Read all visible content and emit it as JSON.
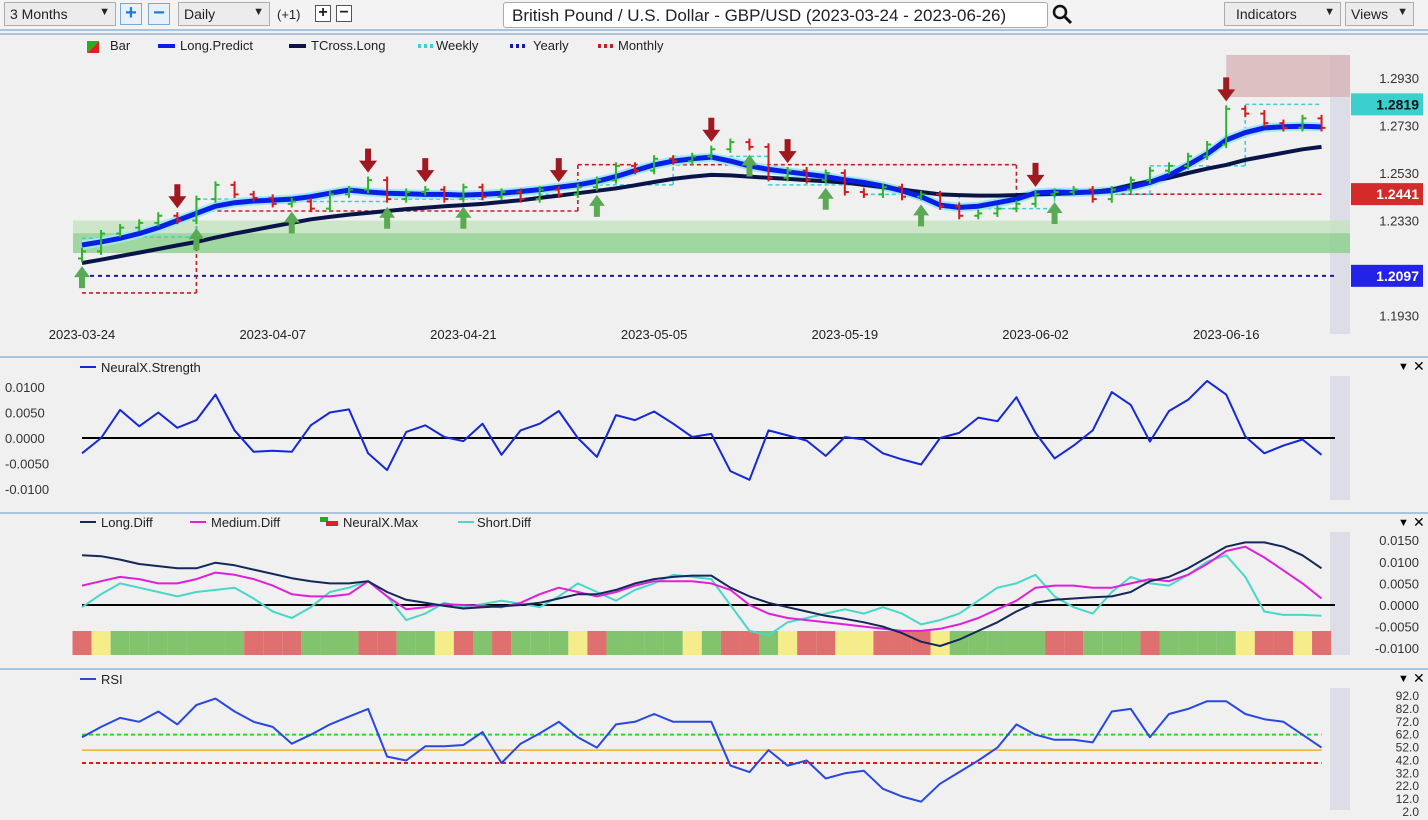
{
  "toolbar": {
    "range": "3 Months",
    "interval": "Daily",
    "offset": "(+1)",
    "title": "British Pound / U.S. Dollar - GBP/USD (2023-03-24 - 2023-06-26)",
    "indicators": "Indicators",
    "views": "Views"
  },
  "colors": {
    "long_predict": "#0a1fe6",
    "tcross": "#0a1448",
    "weekly": "#3ccfd0",
    "yearly": "#1a1ab0",
    "monthly": "#c0202a",
    "bar_up": "#2db32d",
    "bar_down": "#d41c1c",
    "arrow_up": "#5aaa55",
    "arrow_down": "#a01820",
    "strength": "#1428d8",
    "long_diff": "#14285a",
    "medium_diff": "#e020d8",
    "short_diff": "#48d8c8",
    "rsi": "#2848e0",
    "max_green": "#82c46e",
    "max_red": "#e07070",
    "max_yellow": "#f5ec8a"
  },
  "main": {
    "legend": [
      "Bar",
      "Long.Predict",
      "TCross.Long",
      "Weekly",
      "Yearly",
      "Monthly"
    ],
    "x_ticks": [
      "2023-03-24",
      "2023-04-07",
      "2023-04-21",
      "2023-05-05",
      "2023-05-19",
      "2023-06-02",
      "2023-06-16"
    ],
    "y_ticks": [
      "1.2930",
      "1.2730",
      "1.2530",
      "1.2330",
      "1.1930"
    ],
    "price_labels": [
      {
        "text": "1.2819",
        "value": 1.2819,
        "color": "#3ccfd0"
      },
      {
        "text": "1.2441",
        "value": 1.2441,
        "color": "#d42a2a"
      },
      {
        "text": "1.2097",
        "value": 1.2097,
        "color": "#2222e8"
      }
    ],
    "dates": [
      "2023-03-24",
      "2023-03-27",
      "2023-03-28",
      "2023-03-29",
      "2023-03-30",
      "2023-03-31",
      "2023-04-03",
      "2023-04-04",
      "2023-04-05",
      "2023-04-06",
      "2023-04-07",
      "2023-04-10",
      "2023-04-11",
      "2023-04-12",
      "2023-04-13",
      "2023-04-14",
      "2023-04-17",
      "2023-04-18",
      "2023-04-19",
      "2023-04-20",
      "2023-04-21",
      "2023-04-24",
      "2023-04-25",
      "2023-04-26",
      "2023-04-27",
      "2023-04-28",
      "2023-05-01",
      "2023-05-02",
      "2023-05-03",
      "2023-05-04",
      "2023-05-05",
      "2023-05-08",
      "2023-05-09",
      "2023-05-10",
      "2023-05-11",
      "2023-05-12",
      "2023-05-15",
      "2023-05-16",
      "2023-05-17",
      "2023-05-18",
      "2023-05-19",
      "2023-05-22",
      "2023-05-23",
      "2023-05-24",
      "2023-05-25",
      "2023-05-26",
      "2023-05-29",
      "2023-05-30",
      "2023-05-31",
      "2023-06-01",
      "2023-06-02",
      "2023-06-05",
      "2023-06-06",
      "2023-06-07",
      "2023-06-08",
      "2023-06-09",
      "2023-06-12",
      "2023-06-13",
      "2023-06-14",
      "2023-06-15",
      "2023-06-16",
      "2023-06-19",
      "2023-06-20",
      "2023-06-21",
      "2023-06-22",
      "2023-06-23"
    ],
    "close": [
      1.22,
      1.2275,
      1.23,
      1.232,
      1.235,
      1.233,
      1.242,
      1.248,
      1.244,
      1.2425,
      1.24,
      1.241,
      1.238,
      1.244,
      1.246,
      1.25,
      1.242,
      1.245,
      1.246,
      1.242,
      1.247,
      1.243,
      1.245,
      1.242,
      1.246,
      1.244,
      1.247,
      1.25,
      1.256,
      1.254,
      1.259,
      1.258,
      1.26,
      1.263,
      1.266,
      1.264,
      1.251,
      1.254,
      1.25,
      1.253,
      1.245,
      1.244,
      1.247,
      1.243,
      1.244,
      1.239,
      1.235,
      1.236,
      1.238,
      1.24,
      1.244,
      1.245,
      1.246,
      1.242,
      1.246,
      1.25,
      1.254,
      1.256,
      1.26,
      1.265,
      1.28,
      1.278,
      1.274,
      1.272,
      1.276,
      1.272
    ],
    "long_predict": [
      1.2227,
      1.224,
      1.2255,
      1.2275,
      1.23,
      1.233,
      1.236,
      1.239,
      1.2405,
      1.2412,
      1.2416,
      1.242,
      1.243,
      1.2445,
      1.2458,
      1.245,
      1.2445,
      1.2443,
      1.244,
      1.244,
      1.2437,
      1.244,
      1.2445,
      1.2452,
      1.246,
      1.247,
      1.248,
      1.2495,
      1.2515,
      1.254,
      1.2564,
      1.258,
      1.259,
      1.2597,
      1.258,
      1.256,
      1.2545,
      1.2535,
      1.2525,
      1.2515,
      1.2501,
      1.249,
      1.2475,
      1.2455,
      1.243,
      1.2395,
      1.2385,
      1.239,
      1.2405,
      1.242,
      1.2446,
      1.245,
      1.2448,
      1.245,
      1.2455,
      1.247,
      1.249,
      1.252,
      1.2564,
      1.261,
      1.2669,
      1.27,
      1.272,
      1.2725,
      1.2727,
      1.2724
    ],
    "tcross_long": [
      1.2151,
      1.2165,
      1.218,
      1.2195,
      1.221,
      1.2225,
      1.224,
      1.2258,
      1.2275,
      1.229,
      1.2305,
      1.232,
      1.2335,
      1.2345,
      1.2355,
      1.2362,
      1.237,
      1.2378,
      1.2384,
      1.239,
      1.2395,
      1.24,
      1.2408,
      1.2415,
      1.2425,
      1.2435,
      1.2445,
      1.2455,
      1.2465,
      1.2478,
      1.2492,
      1.2505,
      1.2515,
      1.2522,
      1.252,
      1.2515,
      1.251,
      1.2505,
      1.25,
      1.2495,
      1.249,
      1.248,
      1.247,
      1.246,
      1.245,
      1.244,
      1.2437,
      1.2435,
      1.2435,
      1.2437,
      1.244,
      1.2442,
      1.2445,
      1.245,
      1.246,
      1.2479,
      1.2495,
      1.251,
      1.253,
      1.2548,
      1.2564,
      1.2585,
      1.26,
      1.2615,
      1.263,
      1.264
    ],
    "weekly": [
      {
        "from": "2023-03-24",
        "value": 1.2255
      },
      {
        "from": "2023-03-27",
        "value": 1.226
      },
      {
        "from": "2023-04-03",
        "value": 1.242
      },
      {
        "from": "2023-04-10",
        "value": 1.241
      },
      {
        "from": "2023-04-17",
        "value": 1.242
      },
      {
        "from": "2023-04-24",
        "value": 1.244
      },
      {
        "from": "2023-05-01",
        "value": 1.248
      },
      {
        "from": "2023-05-08",
        "value": 1.26
      },
      {
        "from": "2023-05-15",
        "value": 1.248
      },
      {
        "from": "2023-05-22",
        "value": 1.244
      },
      {
        "from": "2023-05-29",
        "value": 1.238
      },
      {
        "from": "2023-06-05",
        "value": 1.244
      },
      {
        "from": "2023-06-12",
        "value": 1.256
      },
      {
        "from": "2023-06-19",
        "value": 1.2819
      }
    ],
    "monthly": [
      {
        "from": "2023-03-24",
        "value": 1.2025
      },
      {
        "from": "2023-04-03",
        "value": 1.237
      },
      {
        "from": "2023-05-01",
        "value": 1.2565
      },
      {
        "from": "2023-06-01",
        "value": 1.2441
      }
    ],
    "yearly": 1.2097,
    "down_signals": [
      "2023-03-31",
      "2023-04-14",
      "2023-04-19",
      "2023-04-28",
      "2023-05-10",
      "2023-05-16",
      "2023-06-02",
      "2023-06-16"
    ],
    "up_signals": [
      "2023-03-24",
      "2023-04-03",
      "2023-04-10",
      "2023-04-17",
      "2023-04-21",
      "2023-05-02",
      "2023-05-12",
      "2023-05-18",
      "2023-05-25",
      "2023-06-05"
    ],
    "zones": [
      {
        "low": 1.2193,
        "high": 1.2277,
        "color": "#8cd08c"
      },
      {
        "low": 1.2277,
        "high": 1.233,
        "color": "#c4e4c0"
      },
      {
        "low": 1.285,
        "high": 1.3027,
        "color": "#d8b4b6",
        "from": "2023-06-16"
      }
    ]
  },
  "strength": {
    "legend": "NeuralX.Strength",
    "y_ticks": [
      "0.0100",
      "0.0050",
      "0.0000",
      "-0.0050",
      "-0.0100"
    ],
    "values": [
      -0.003,
      0,
      0.0055,
      0.0023,
      0.005,
      0.002,
      0.0035,
      0.0085,
      0.0015,
      -0.0027,
      -0.0025,
      -0.0027,
      0.0025,
      0.005,
      0.0056,
      -0.003,
      -0.0063,
      0.0012,
      0.0025,
      0.0002,
      -0.0006,
      0.0028,
      -0.0033,
      0.0015,
      0.0028,
      0.0053,
      0,
      -0.0037,
      0.0045,
      0.0035,
      0.0052,
      0.0028,
      0.0002,
      0.0008,
      -0.0065,
      -0.0082,
      0.0015,
      0.0005,
      -0.0005,
      -0.0035,
      0.0002,
      -0.0003,
      -0.003,
      -0.0042,
      -0.0052,
      0,
      0.001,
      0.004,
      0.0033,
      0.008,
      0.001,
      -0.004,
      -0.0015,
      0.0015,
      0.009,
      0.0065,
      -0.0007,
      0.0053,
      0.0075,
      0.0112,
      0.0085,
      0.0003,
      -0.003,
      -0.0015,
      -0.0003,
      -0.0033
    ]
  },
  "diff": {
    "legend": [
      "Long.Diff",
      "Medium.Diff",
      "NeuralX.Max",
      "Short.Diff"
    ],
    "y_ticks": [
      "0.0150",
      "0.0100",
      "0.0050",
      "0.0000",
      "-0.0050",
      "-0.0100"
    ],
    "long": [
      0.0115,
      0.0113,
      0.0105,
      0.0095,
      0.009,
      0.0085,
      0.0085,
      0.0098,
      0.0092,
      0.0082,
      0.0072,
      0.0062,
      0.0055,
      0.005,
      0.005,
      0.0055,
      0.003,
      0.0012,
      0.0005,
      -0.0002,
      -0.0008,
      -0.0005,
      -0.0003,
      0,
      0.0005,
      0.0015,
      0.0025,
      0.0025,
      0.0035,
      0.005,
      0.006,
      0.0065,
      0.0068,
      0.0068,
      0.004,
      0.002,
      0.0005,
      -0.0005,
      -0.0015,
      -0.0025,
      -0.0032,
      -0.004,
      -0.005,
      -0.0065,
      -0.0085,
      -0.0095,
      -0.008,
      -0.006,
      -0.004,
      -0.0015,
      0.0005,
      0.0012,
      0.0015,
      0.0018,
      0.002,
      0.003,
      0.0055,
      0.0065,
      0.0085,
      0.011,
      0.0135,
      0.0145,
      0.0145,
      0.0135,
      0.0115,
      0.0085
    ],
    "medium": [
      0.0045,
      0.0055,
      0.0065,
      0.006,
      0.005,
      0.005,
      0.006,
      0.0075,
      0.007,
      0.006,
      0.0045,
      0.0025,
      0.002,
      0.002,
      0.0025,
      0.0055,
      0.002,
      -0.001,
      -0.0005,
      0.0002,
      0,
      -0.0002,
      -0.0005,
      0.0005,
      0.0025,
      0.004,
      0.003,
      0.002,
      0.003,
      0.0045,
      0.0055,
      0.0055,
      0.0055,
      0.005,
      0.0035,
      0,
      -0.002,
      -0.003,
      -0.0035,
      -0.004,
      -0.0045,
      -0.005,
      -0.0055,
      -0.006,
      -0.006,
      -0.0055,
      -0.0045,
      -0.003,
      -0.001,
      0.001,
      0.004,
      0.0045,
      0.0045,
      0.004,
      0.004,
      0.005,
      0.006,
      0.0055,
      0.007,
      0.0095,
      0.0125,
      0.0135,
      0.011,
      0.008,
      0.005,
      0.0015
    ],
    "short": [
      -0.0005,
      0.0025,
      0.005,
      0.004,
      0.003,
      0.002,
      0.003,
      0.0035,
      0.004,
      0.0015,
      -0.0015,
      -0.003,
      -0.0005,
      0.003,
      0.004,
      0.0055,
      0.002,
      -0.0035,
      -0.002,
      0.0005,
      -0.0005,
      0.0002,
      0.001,
      0.0003,
      -0.0005,
      0.002,
      0.005,
      0.003,
      0.001,
      0.0035,
      0.005,
      0.007,
      0.0065,
      0.006,
      0,
      -0.006,
      -0.007,
      -0.004,
      -0.003,
      -0.002,
      -0.001,
      -0.002,
      -0.0005,
      -0.002,
      -0.0045,
      -0.0035,
      -0.002,
      0.001,
      0.004,
      0.005,
      0.007,
      0.002,
      -0.0005,
      -0.002,
      0.003,
      0.0065,
      0.005,
      0.0045,
      0.007,
      0.01,
      0.0115,
      0.0065,
      -0.0015,
      -0.0023,
      -0.0023,
      -0.0025
    ],
    "neuralx_max": "RYGGGGGGGRRRGGGRRGGYRGRGGGYRGGGGYGRRGYRRYYRRRYGGGGGRRGGGRGGGGYRRYR"
  },
  "rsi": {
    "legend": "RSI",
    "y_ticks": [
      "92.0",
      "82.0",
      "72.0",
      "62.0",
      "52.0",
      "42.0",
      "32.0",
      "22.0",
      "12.0",
      "2.0"
    ],
    "levels": {
      "upper": 62,
      "mid": 50,
      "lower": 40
    },
    "values": [
      60,
      68,
      75,
      72,
      80,
      70,
      85,
      90,
      80,
      72,
      68,
      55,
      62,
      70,
      76,
      82,
      45,
      42,
      53,
      53,
      54,
      64,
      40,
      55,
      63,
      72,
      60,
      52,
      70,
      72,
      78,
      72,
      72,
      72,
      38,
      33,
      50,
      38,
      42,
      28,
      32,
      34,
      20,
      14,
      10,
      24,
      33,
      42,
      52,
      70,
      62,
      58,
      58,
      56,
      80,
      82,
      60,
      78,
      82,
      88,
      88,
      78,
      74,
      72,
      62,
      52
    ]
  }
}
